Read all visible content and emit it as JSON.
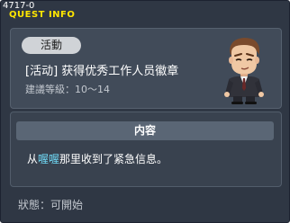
{
  "window": {
    "corner_id": "4717-0",
    "title": "QUEST INFO"
  },
  "quest": {
    "badge": "活動",
    "name": "[活动] 获得优秀工作人员徽章",
    "level": "建議等級：10～14",
    "npc_icon": "npc-portrait-icon"
  },
  "content": {
    "header": "内容",
    "text_before": "从",
    "text_highlight": "喔喔",
    "text_after": "那里收到了紧急信息。",
    "highlight_color": "#6fd6f2"
  },
  "status": {
    "text": "狀態：可開始"
  },
  "colors": {
    "title": "#ffe600",
    "window_bg": "#2f3744",
    "panel_bg": "#414b59",
    "header_bg": "#5a6675"
  }
}
